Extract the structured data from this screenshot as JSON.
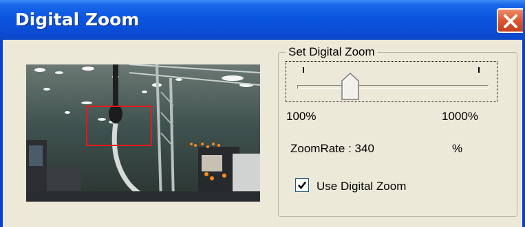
{
  "window": {
    "title": "Digital Zoom"
  },
  "zoom": {
    "group_label": "Set Digital Zoom",
    "min_label": "100%",
    "max_label": "1000%",
    "min_value": 100,
    "max_value": 1000,
    "current_value": 340,
    "rate_label": "ZoomRate : 340",
    "unit": "%"
  },
  "use_digital_zoom": {
    "label": "Use Digital Zoom",
    "checked": true
  },
  "colors": {
    "title_bar": "#0a4fd8",
    "dialog_bg": "#ece9d8",
    "zoom_rect": "#e81818",
    "close_button": "#d9532c"
  },
  "icons": {
    "close": "close-icon",
    "check": "check-icon"
  }
}
